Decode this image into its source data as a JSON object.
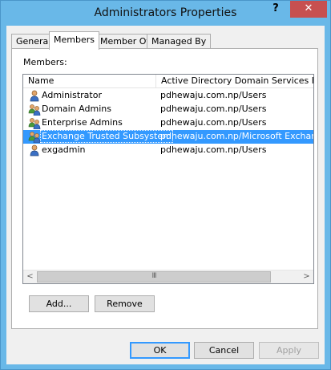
{
  "window": {
    "title": "Administrators Properties",
    "help_label": "?",
    "close_label": "✕"
  },
  "tabs": [
    {
      "label": "General",
      "active": false
    },
    {
      "label": "Members",
      "active": true
    },
    {
      "label": "Member Of",
      "active": false
    },
    {
      "label": "Managed By",
      "active": false
    }
  ],
  "members": {
    "label": "Members:",
    "columns": [
      "Name",
      "Active Directory Domain Services Folder"
    ],
    "rows": [
      {
        "name": "Administrator",
        "folder": "pdhewaju.com.np/Users",
        "icon": "user-icon",
        "selected": false
      },
      {
        "name": "Domain Admins",
        "folder": "pdhewaju.com.np/Users",
        "icon": "group-icon",
        "selected": false
      },
      {
        "name": "Enterprise Admins",
        "folder": "pdhewaju.com.np/Users",
        "icon": "group-icon",
        "selected": false
      },
      {
        "name": "Exchange Trusted Subsystem",
        "folder": "pdhewaju.com.np/Microsoft Exchange",
        "icon": "group-icon",
        "selected": true
      },
      {
        "name": "exgadmin",
        "folder": "pdhewaju.com.np/Users",
        "icon": "user-icon",
        "selected": false
      }
    ],
    "scrollbar": {
      "left": "<",
      "thumb": "III",
      "right": ">"
    }
  },
  "buttons": {
    "add": "Add...",
    "remove": "Remove",
    "ok": "OK",
    "cancel": "Cancel",
    "apply": "Apply"
  },
  "colors": {
    "titlebar": "#69b8e8",
    "close": "#c75050",
    "selection": "#3399ff"
  }
}
